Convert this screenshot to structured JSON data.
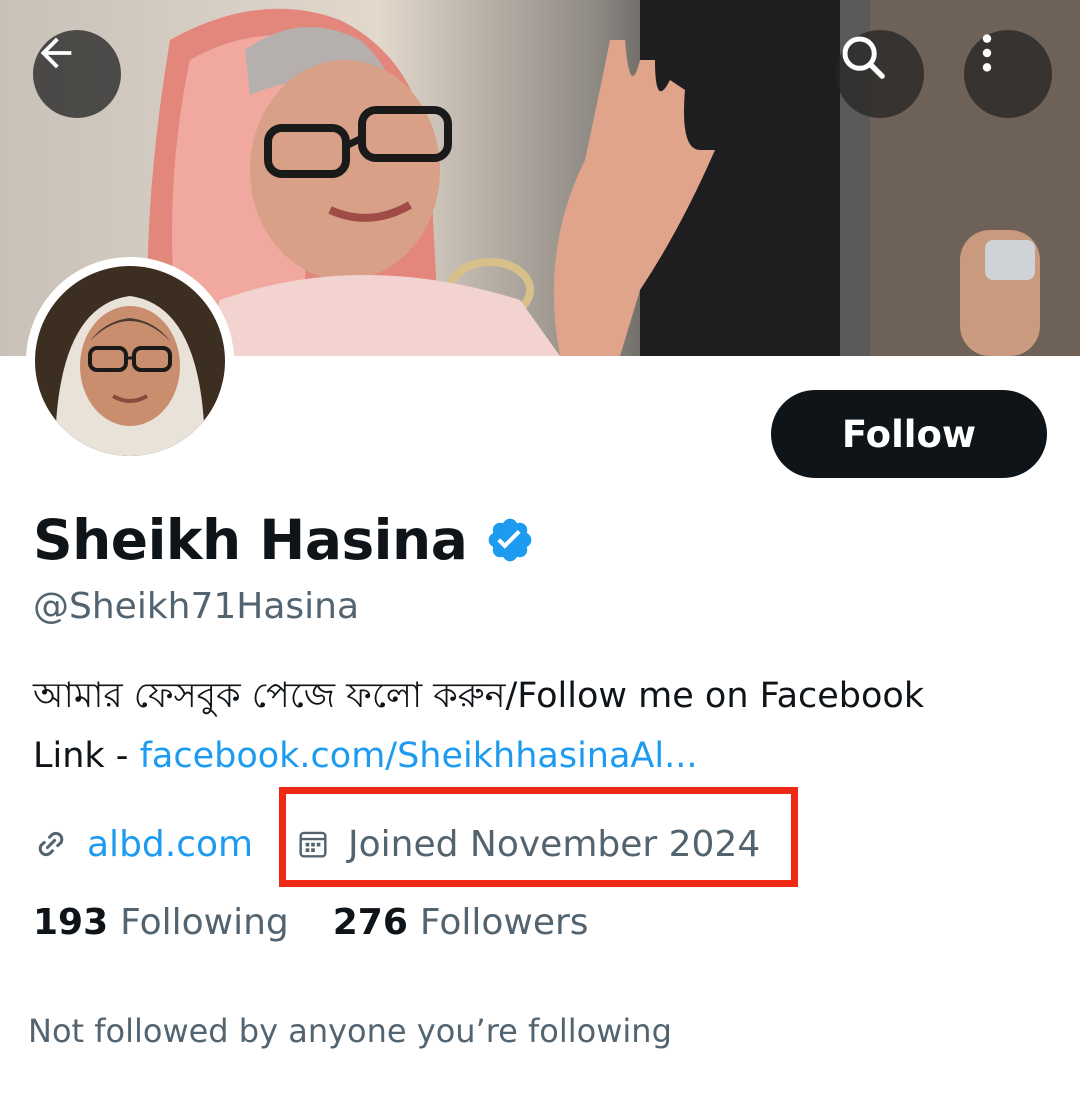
{
  "header": {
    "back_icon": "arrow-left-icon",
    "search_icon": "search-icon",
    "more_icon": "more-vertical-icon"
  },
  "profile": {
    "display_name": "Sheikh Hasina",
    "verified_badge_color": "#1d9bf0",
    "handle": "@Sheikh71Hasina",
    "follow_label": "Follow",
    "bio_line1": "আমার ফেসবুক পেজে ফলো করুন/Follow me on Facebook",
    "bio_line2_prefix": "Link - ",
    "bio_link": "facebook.com/SheikhhasinaAl...",
    "website": "albd.com",
    "joined": "Joined November 2024",
    "following_count": "193",
    "following_label": "Following",
    "followers_count": "276",
    "followers_label": "Followers",
    "mutuals_note": "Not followed by anyone you’re following"
  },
  "colors": {
    "accent": "#1d9bf0",
    "text_primary": "#0f1419",
    "text_secondary": "#536471",
    "highlight_box": "#ee2a14"
  }
}
